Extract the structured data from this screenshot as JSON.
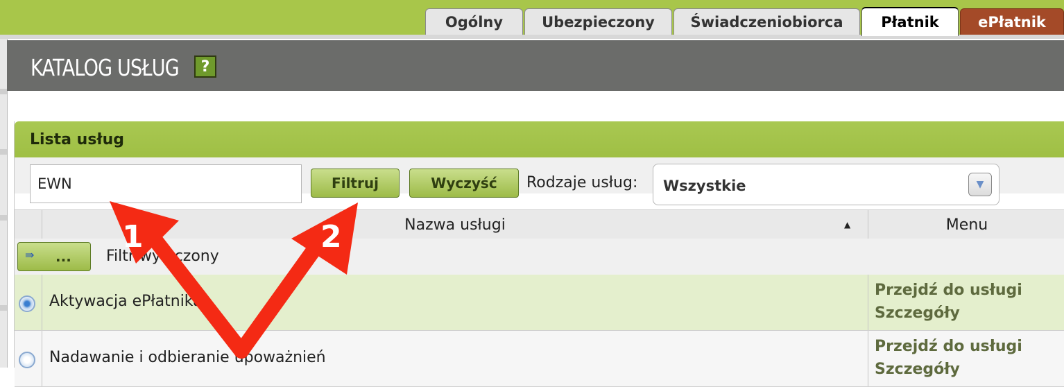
{
  "tabs": [
    {
      "label": "Ogólny",
      "active": false
    },
    {
      "label": "Ubezpieczony",
      "active": false
    },
    {
      "label": "Świadczeniobiorca",
      "active": false
    },
    {
      "label": "Płatnik",
      "active": true
    },
    {
      "label": "ePłatnik",
      "active": false
    }
  ],
  "header": {
    "title": "KATALOG USŁUG",
    "help": "?"
  },
  "panel": {
    "title": "Lista usług",
    "filter_value": "EWN",
    "filter_button": "Filtruj",
    "clear_button": "Wyczyść",
    "type_label": "Rodzaje usług:",
    "type_value": "Wszystkie"
  },
  "table": {
    "columns": {
      "name": "Nazwa usługi",
      "menu": "Menu"
    },
    "filter_status": "Filtr wyłączony",
    "filter_toggle": "...",
    "rows": [
      {
        "name": "Aktywacja ePłatnika",
        "link1": "Przejdź do usługi",
        "link2": "Szczegóły",
        "selected": true
      },
      {
        "name": "Nadawanie i odbieranie upoważnień",
        "link1": "Przejdź do usługi",
        "link2": "Szczegóły",
        "selected": false
      }
    ]
  },
  "annotations": {
    "arrow1": "1",
    "arrow2": "2"
  },
  "colors": {
    "accent": "#a8c64a",
    "header": "#6b6c6a",
    "eplatnik": "#a44a28",
    "arrow": "#f42a14"
  }
}
